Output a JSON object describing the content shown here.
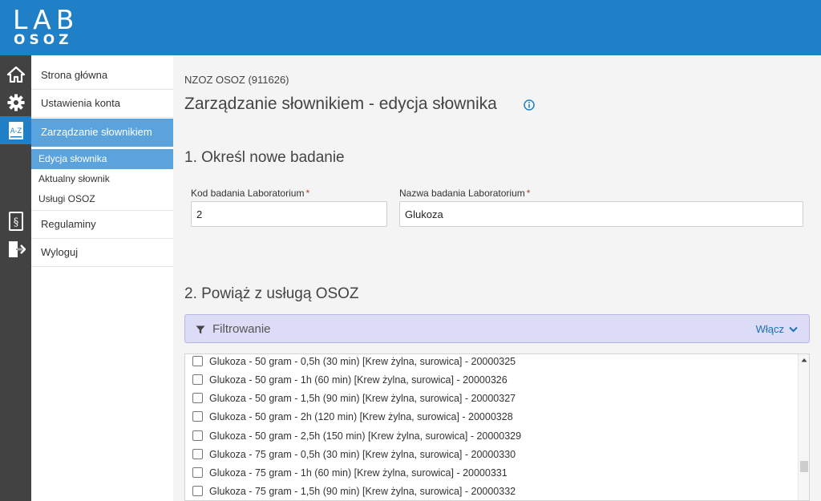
{
  "brand": {
    "logo_top": "LAB",
    "logo_bottom": "OSOZ"
  },
  "iconbar": [
    {
      "icon": "home-icon"
    },
    {
      "icon": "gear-icon"
    },
    {
      "icon": "dictionary-az-icon",
      "label": "A-Z"
    },
    {
      "icon": "regulations-icon",
      "label": "§"
    },
    {
      "icon": "logout-icon"
    }
  ],
  "nav": {
    "items": [
      {
        "label": "Strona główna"
      },
      {
        "label": "Ustawienia konta"
      },
      {
        "label": "Zarządzanie słownikiem"
      },
      {
        "label": "Regulaminy"
      },
      {
        "label": "Wyloguj"
      }
    ],
    "subitems": [
      {
        "label": "Edycja słownika"
      },
      {
        "label": "Aktualny słownik"
      },
      {
        "label": "Usługi OSOZ"
      }
    ]
  },
  "page": {
    "org": "NZOZ OSOZ (911626)",
    "title": "Zarządzanie słownikiem - edycja słownika",
    "section1_title": "1. Określ nowe badanie",
    "section2_title": "2. Powiąż z usługą OSOZ"
  },
  "form": {
    "code_label": "Kod badania Laboratorium",
    "code_value": "2",
    "name_label": "Nazwa badania Laboratorium",
    "name_value": "Glukoza",
    "required_mark": "*"
  },
  "filter": {
    "label": "Filtrowanie",
    "toggle_label": "Włącz"
  },
  "services": [
    "Glukoza - 50 gram - 0,5h (30 min) [Krew żylna, surowica] - 20000325",
    "Glukoza - 50 gram - 1h (60 min) [Krew żylna, surowica] - 20000326",
    "Glukoza - 50 gram - 1,5h (90 min) [Krew żylna, surowica] - 20000327",
    "Glukoza - 50 gram - 2h (120 min) [Krew żylna, surowica] - 20000328",
    "Glukoza - 50 gram - 2,5h (150 min) [Krew żylna, surowica] - 20000329",
    "Glukoza - 75 gram - 0,5h (30 min) [Krew żylna, surowica] - 20000330",
    "Glukoza - 75 gram - 1h (60 min) [Krew żylna, surowica] - 20000331",
    "Glukoza - 75 gram - 1,5h (90 min) [Krew żylna, surowica] - 20000332"
  ],
  "colors": {
    "header": "#1f80c8",
    "active_nav": "#5aa3dc",
    "iconbar": "#424242",
    "filter_bg": "#dcdcf6"
  }
}
